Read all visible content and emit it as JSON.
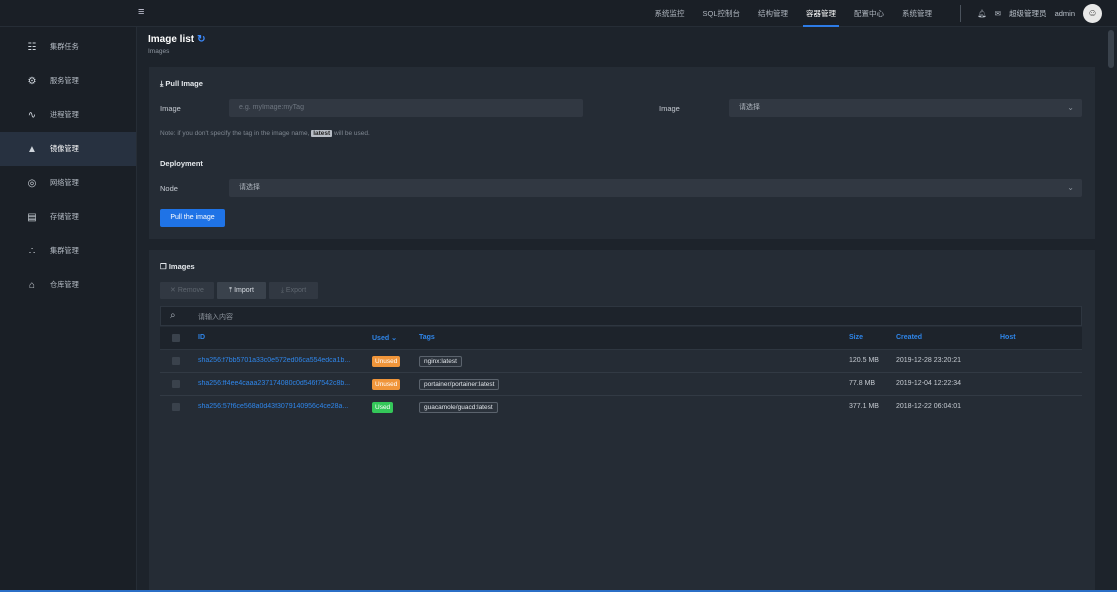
{
  "topnav": {
    "items": [
      "系统监控",
      "SQL控制台",
      "结构管理",
      "容器管理",
      "配置中心",
      "系统管理"
    ],
    "active": "容器管理",
    "user_role": "超级管理员",
    "username": "admin"
  },
  "sidebar": {
    "items": [
      {
        "label": "集群任务",
        "icon": "cluster-tasks-icon"
      },
      {
        "label": "服务管理",
        "icon": "service-icon"
      },
      {
        "label": "进程管理",
        "icon": "process-icon"
      },
      {
        "label": "镜像管理",
        "icon": "image-icon",
        "active": true
      },
      {
        "label": "网络管理",
        "icon": "globe-icon"
      },
      {
        "label": "存储管理",
        "icon": "storage-icon"
      },
      {
        "label": "集群管理",
        "icon": "cluster-icon"
      },
      {
        "label": "仓库管理",
        "icon": "warehouse-icon"
      }
    ]
  },
  "page": {
    "title": "Image list",
    "subtitle": "Images"
  },
  "pull": {
    "header": "Pull Image",
    "image_label": "Image",
    "image_placeholder": "e.g. myImage:myTag",
    "registry_label": "Image",
    "registry_value": "请选择",
    "note_before": "Note: if you don't specify the tag in the image name,",
    "note_tag": "latest",
    "note_after": "will be used.",
    "deployment_header": "Deployment",
    "node_label": "Node",
    "node_value": "请选择",
    "button": "Pull the image"
  },
  "images": {
    "header": "Images",
    "toolbar": {
      "remove": "Remove",
      "import": "Import",
      "export": "Export"
    },
    "search_placeholder": "请输入内容",
    "columns": {
      "id": "ID",
      "used": "Used",
      "tags": "Tags",
      "size": "Size",
      "created": "Created",
      "host": "Host"
    },
    "rows": [
      {
        "id": "sha256:f7bb5701a33c0e572ed06ca554edca1b...",
        "used": "Unused",
        "tag": "nginx:latest",
        "size": "120.5 MB",
        "created": "2019-12-28 23:20:21"
      },
      {
        "id": "sha256:ff4ee4caaa237174080c0d546f7542c8b...",
        "used": "Unused",
        "tag": "portainer/portainer:latest",
        "size": "77.8 MB",
        "created": "2019-12-04 12:22:34"
      },
      {
        "id": "sha256:57f6ce568a0d43f3079140956c4ce28a...",
        "used": "Used",
        "tag": "guacamole/guacd:latest",
        "size": "377.1 MB",
        "created": "2018-12-22 06:04:01"
      }
    ]
  }
}
